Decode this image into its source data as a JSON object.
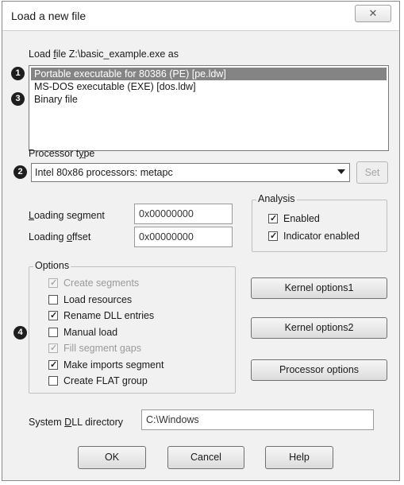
{
  "window": {
    "title": "Load a new file",
    "close_glyph": "✕"
  },
  "load_label": {
    "pre": "Load ",
    "u": "f",
    "post": "ile Z:\\basic_example.exe as"
  },
  "file_types": [
    {
      "label": "Portable executable for 80386 (PE) [pe.ldw]",
      "selected": true
    },
    {
      "label": "MS-DOS executable (EXE) [dos.ldw]",
      "selected": false
    },
    {
      "label": "Binary file",
      "selected": false
    }
  ],
  "badges": {
    "one": "1",
    "two": "2",
    "three": "3",
    "four": "4"
  },
  "processor": {
    "label_pre": "Processor t",
    "label_u": "y",
    "label_post": "pe",
    "value": "Intel 80x86 processors: metapc",
    "set_label": "Set"
  },
  "loading_segment": {
    "label_u": "L",
    "label_post": "oading segment",
    "value": "0x00000000"
  },
  "loading_offset": {
    "label_pre": "Loading ",
    "label_u": "o",
    "label_post": "ffset",
    "value": "0x00000000"
  },
  "analysis": {
    "title": "Analysis",
    "enabled": {
      "label": "Enabled",
      "checked": true
    },
    "indicator": {
      "label": "Indicator enabled",
      "checked": true
    }
  },
  "options": {
    "title": "Options",
    "items": [
      {
        "label": "Create segments",
        "checked": true,
        "disabled": true
      },
      {
        "label": "Load resources",
        "checked": false,
        "disabled": false
      },
      {
        "label": "Rename DLL entries",
        "checked": true,
        "disabled": false
      },
      {
        "label": "Manual load",
        "checked": false,
        "disabled": false
      },
      {
        "label": "Fill segment gaps",
        "checked": true,
        "disabled": true
      },
      {
        "label": "Make imports segment",
        "checked": true,
        "disabled": false
      },
      {
        "label": "Create FLAT group",
        "checked": false,
        "disabled": false
      }
    ]
  },
  "buttons": {
    "kernel1": "Kernel options1",
    "kernel2": "Kernel options2",
    "processor_options": "Processor options",
    "ok": "OK",
    "cancel": "Cancel",
    "help": "Help"
  },
  "dll_dir": {
    "label_pre": "System ",
    "label_u": "D",
    "label_post": "LL directory",
    "value": "C:\\Windows"
  }
}
